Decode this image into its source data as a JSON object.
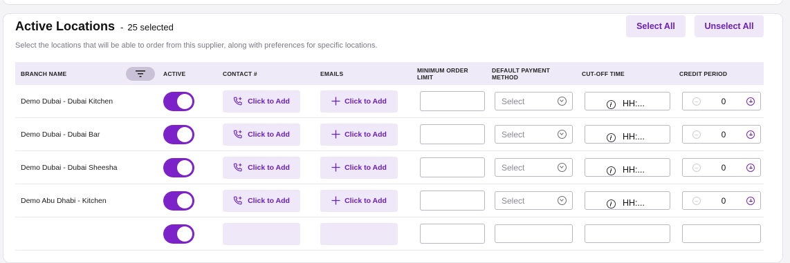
{
  "header": {
    "title": "Active Locations",
    "separator": "-",
    "selected_count": "25 selected",
    "subtitle": "Select the locations that will be able to order from this supplier, along with preferences for specific locations.",
    "select_all_label": "Select All",
    "unselect_all_label": "Unselect All"
  },
  "table": {
    "columns": {
      "branch": "BRANCH NAME",
      "active": "ACTIVE",
      "contact": "CONTACT #",
      "emails": "EMAILS",
      "min_order": "MINIMUM ORDER LIMIT",
      "payment": "DEFAULT PAYMENT METHOD",
      "cutoff": "CUT-OFF TIME",
      "credit": "CREDIT PERIOD"
    },
    "rows": [
      {
        "branch": "Demo Dubai - Dubai Kitchen",
        "active": true,
        "contact": "Click to Add",
        "emails": "Click to Add",
        "min_order": "",
        "payment": "Select",
        "cutoff": "HH:...",
        "credit": "0"
      },
      {
        "branch": "Demo Dubai - Dubai Bar",
        "active": true,
        "contact": "Click to Add",
        "emails": "Click to Add",
        "min_order": "",
        "payment": "Select",
        "cutoff": "HH:...",
        "credit": "0"
      },
      {
        "branch": "Demo Dubai - Dubai Sheesha",
        "active": true,
        "contact": "Click to Add",
        "emails": "Click to Add",
        "min_order": "",
        "payment": "Select",
        "cutoff": "HH:...",
        "credit": "0"
      },
      {
        "branch": "Demo Abu Dhabi - Kitchen",
        "active": true,
        "contact": "Click to Add",
        "emails": "Click to Add",
        "min_order": "",
        "payment": "Select",
        "cutoff": "HH:...",
        "credit": "0"
      },
      {
        "branch": "",
        "active": true,
        "contact": "",
        "emails": "",
        "min_order": "",
        "payment": "",
        "cutoff": "",
        "credit": ""
      }
    ]
  },
  "icons": {
    "filter": "filter-icon",
    "phone": "phone-add-icon",
    "plus": "plus-icon",
    "chevron": "chevron-down-icon",
    "clock": "clock-icon",
    "minus": "minus-circle-icon",
    "plus_circle": "plus-circle-icon"
  },
  "colors": {
    "accent": "#7b22c9",
    "accent_text": "#6a1fb8",
    "button_bg": "#efe8f9",
    "header_bg": "#efeaf7"
  }
}
